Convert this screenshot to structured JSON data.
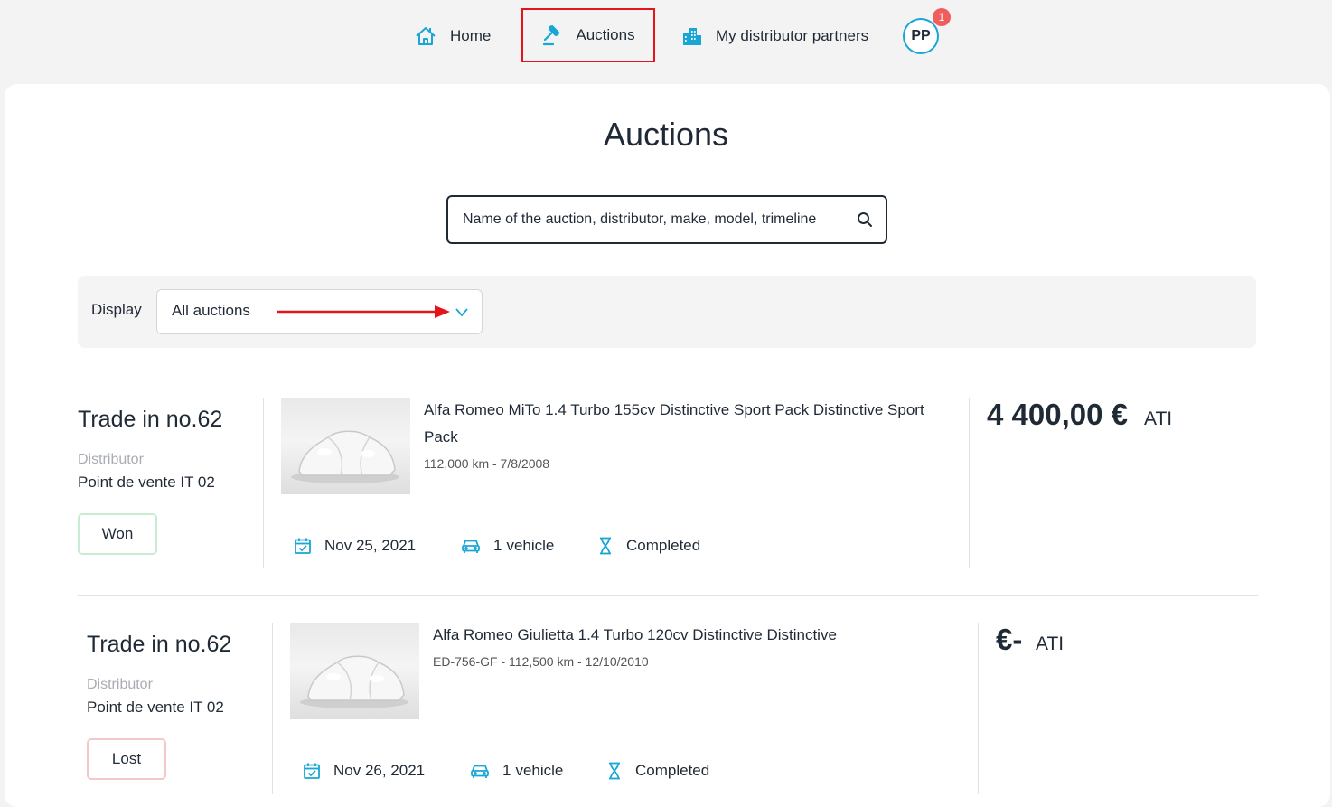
{
  "nav": {
    "home_label": "Home",
    "auctions_label": "Auctions",
    "partners_label": "My distributor partners",
    "avatar_initials": "PP",
    "notification_count": "1",
    "accent_color": "#17a6d6",
    "highlight_color": "#e3151a"
  },
  "page": {
    "title": "Auctions"
  },
  "search": {
    "placeholder": "Name of the auction, distributor, make, model, trimeline"
  },
  "filter": {
    "label": "Display",
    "selected": "All auctions"
  },
  "auctions": [
    {
      "title": "Trade in no.62",
      "distributor_label": "Distributor",
      "distributor": "Point de vente IT 02",
      "status": "Won",
      "vehicle_name": "Alfa Romeo MiTo 1.4 Turbo 155cv Distinctive Sport Pack Distinctive Sport Pack",
      "vehicle_meta": "112,000 km - 7/8/2008",
      "date": "Nov 25, 2021",
      "vehicle_count": "1",
      "vehicle_word": "vehicle",
      "state": "Completed",
      "price": "4 400,00 €",
      "price_unit": "ATI"
    },
    {
      "title": "Trade in no.62",
      "distributor_label": "Distributor",
      "distributor": "Point de vente IT 02",
      "status": "Lost",
      "vehicle_name": "Alfa Romeo Giulietta 1.4 Turbo 120cv Distinctive Distinctive",
      "vehicle_meta": "ED-756-GF - 112,500 km - 12/10/2010",
      "date": "Nov 26, 2021",
      "vehicle_count": "1",
      "vehicle_word": "vehicle",
      "state": "Completed",
      "price": "€-",
      "price_unit": "ATI"
    }
  ]
}
